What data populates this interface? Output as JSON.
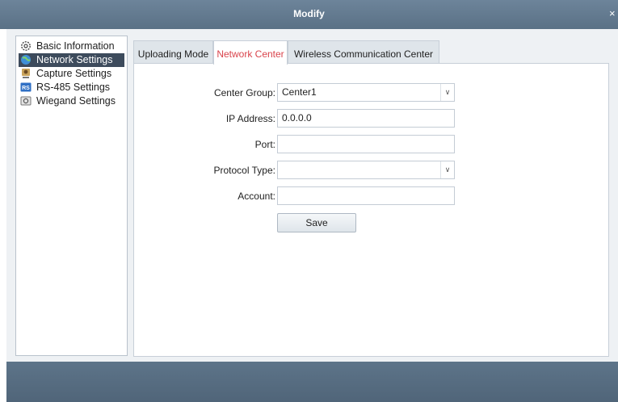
{
  "window": {
    "title": "Modify",
    "close_glyph": "×"
  },
  "sidebar": {
    "items": [
      {
        "label": "Basic Information",
        "icon": "gear-icon",
        "selected": false
      },
      {
        "label": "Network Settings",
        "icon": "network-globe-icon",
        "selected": true
      },
      {
        "label": "Capture Settings",
        "icon": "camera-icon",
        "selected": false
      },
      {
        "label": "RS-485 Settings",
        "icon": "rs-icon",
        "selected": false
      },
      {
        "label": "Wiegand Settings",
        "icon": "wiegand-icon",
        "selected": false
      }
    ]
  },
  "tabs": [
    {
      "label": "Uploading Mode",
      "active": false
    },
    {
      "label": "Network Center",
      "active": true
    },
    {
      "label": "Wireless Communication Center",
      "active": false
    }
  ],
  "form": {
    "center_group": {
      "label": "Center Group:",
      "value": "Center1"
    },
    "ip_address": {
      "label": "IP Address:",
      "value": "0.0.0.0"
    },
    "port": {
      "label": "Port:",
      "value": ""
    },
    "protocol_type": {
      "label": "Protocol Type:",
      "value": ""
    },
    "account": {
      "label": "Account:",
      "value": ""
    },
    "save_label": "Save"
  },
  "colors": {
    "title_bar": "#5f768b",
    "selected_item": "#3d4b5c",
    "active_tab_text": "#d9434b",
    "content_background": "#eef1f4"
  }
}
